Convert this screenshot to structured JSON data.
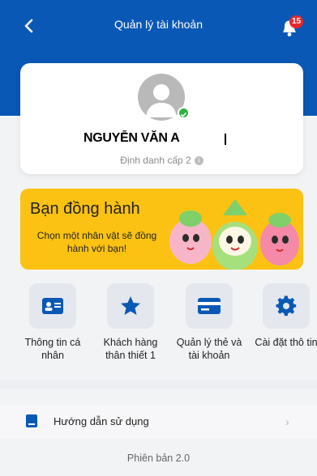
{
  "header": {
    "title": "Quản lý tài khoản",
    "notification_count": "15"
  },
  "profile": {
    "name": "NGUYỄN VĂN A",
    "level": "Định danh cấp 2"
  },
  "banner": {
    "title": "Bạn đồng hành",
    "description": "Chọn một nhân vật sẽ đồng hành với bạn!"
  },
  "shortcuts": [
    {
      "label": "Thông tin cá nhân",
      "icon": "id-card-icon"
    },
    {
      "label": "Khách hàng thân thiết 1",
      "icon": "star-icon"
    },
    {
      "label": "Quản lý thẻ và tài khoản",
      "icon": "credit-card-icon"
    },
    {
      "label": "Cài đặt thô tin",
      "icon": "gear-icon"
    }
  ],
  "menu": {
    "guide_label": "Hướng dẫn sử dụng"
  },
  "footer": {
    "version": "Phiên bản 2.0"
  },
  "colors": {
    "primary": "#0a58b5",
    "banner_bg": "#fbc213",
    "badge": "#e5282b",
    "verified": "#2fb043"
  }
}
